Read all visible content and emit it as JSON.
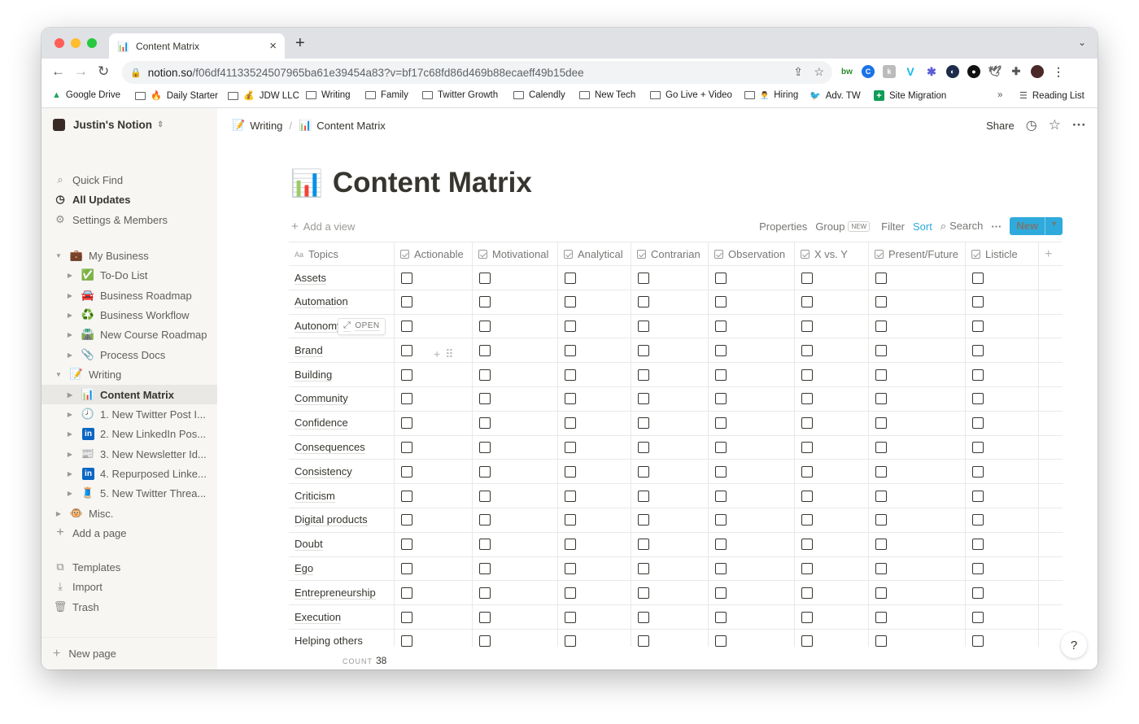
{
  "browser": {
    "tab_title": "Content Matrix",
    "url_host": "notion.so",
    "url_rest": "/f06df41133524507965ba61e39454a83?v=bf17c68fd86d469b88ecaeff49b15dee",
    "bookmarks": [
      {
        "label": "Google Drive",
        "icon": "▲"
      },
      {
        "label": "Daily Starter",
        "icon": "🔥"
      },
      {
        "label": "JDW LLC",
        "icon": "💰"
      },
      {
        "label": "Writing",
        "icon": ""
      },
      {
        "label": "Family",
        "icon": ""
      },
      {
        "label": "Twitter Growth",
        "icon": ""
      },
      {
        "label": "Calendly",
        "icon": ""
      },
      {
        "label": "New Tech",
        "icon": ""
      },
      {
        "label": "Go Live + Video",
        "icon": ""
      },
      {
        "label": "Hiring",
        "icon": "👨‍💼"
      },
      {
        "label": "Adv. TW",
        "icon": "🐦"
      },
      {
        "label": "Site Migration",
        "icon": "+"
      }
    ],
    "bookmarks_overflow": "»",
    "reading_list": "Reading List"
  },
  "sidebar": {
    "workspace": "Justin's Notion",
    "nav": [
      {
        "label": "Quick Find",
        "icon": "⌕"
      },
      {
        "label": "All Updates",
        "icon": "◷"
      },
      {
        "label": "Settings & Members",
        "icon": "⚙"
      }
    ],
    "pages": [
      {
        "label": "My Business",
        "icon": "💼",
        "toggle": "▼",
        "indent": 0
      },
      {
        "label": "To-Do List",
        "icon": "✅",
        "toggle": "▶",
        "indent": 1
      },
      {
        "label": "Business Roadmap",
        "icon": "🚘",
        "toggle": "▶",
        "indent": 1
      },
      {
        "label": "Business Workflow",
        "icon": "♻️",
        "toggle": "▶",
        "indent": 1
      },
      {
        "label": "New Course Roadmap",
        "icon": "🛣️",
        "toggle": "▶",
        "indent": 1
      },
      {
        "label": "Process Docs",
        "icon": "📎",
        "toggle": "▶",
        "indent": 1
      },
      {
        "label": "Writing",
        "icon": "📝",
        "toggle": "▼",
        "indent": 0
      },
      {
        "label": "Content Matrix",
        "icon": "📊",
        "toggle": "▶",
        "indent": 1,
        "active": true
      },
      {
        "label": "1. New Twitter Post I...",
        "icon": "🕗",
        "toggle": "▶",
        "indent": 1
      },
      {
        "label": "2. New LinkedIn Pos...",
        "icon": "in",
        "toggle": "▶",
        "indent": 1
      },
      {
        "label": "3. New Newsletter Id...",
        "icon": "📰",
        "toggle": "▶",
        "indent": 1
      },
      {
        "label": "4. Repurposed Linke...",
        "icon": "in",
        "toggle": "▶",
        "indent": 1
      },
      {
        "label": "5. New Twitter Threa...",
        "icon": "🧵",
        "toggle": "▶",
        "indent": 1
      },
      {
        "label": "Misc.",
        "icon": "🐵",
        "toggle": "▶",
        "indent": 0
      }
    ],
    "add_page": "Add a page",
    "footer": [
      {
        "label": "Templates",
        "icon": "⧉"
      },
      {
        "label": "Import",
        "icon": "⤓"
      },
      {
        "label": "Trash",
        "icon": "🗑"
      }
    ],
    "new_page": "New page"
  },
  "topbar": {
    "crumb_parent": "Writing",
    "crumb_current": "Content Matrix",
    "share": "Share"
  },
  "page": {
    "title": "Content Matrix",
    "add_view": "Add a view",
    "properties": "Properties",
    "group": "Group",
    "group_badge": "NEW",
    "filter": "Filter",
    "sort": "Sort",
    "search": "Search",
    "more": "···",
    "new_button": "New",
    "open_label": "OPEN",
    "count_label": "COUNT",
    "count_value": "38",
    "help": "?"
  },
  "table": {
    "name_header": "Topics",
    "columns": [
      "Actionable",
      "Motivational",
      "Analytical",
      "Contrarian",
      "Observation",
      "X vs. Y",
      "Present/Future",
      "Listicle"
    ],
    "rows": [
      "Assets",
      "Automation",
      "Autonomy",
      "Brand",
      "Building",
      "Community",
      "Confidence",
      "Consequences",
      "Consistency",
      "Criticism",
      "Digital products",
      "Doubt",
      "Ego",
      "Entrepreneurship",
      "Execution",
      "Helping others"
    ]
  },
  "colors": {
    "accent": "#2eaadc",
    "sidebar_bg": "#f7f6f3",
    "text": "#37352f"
  }
}
